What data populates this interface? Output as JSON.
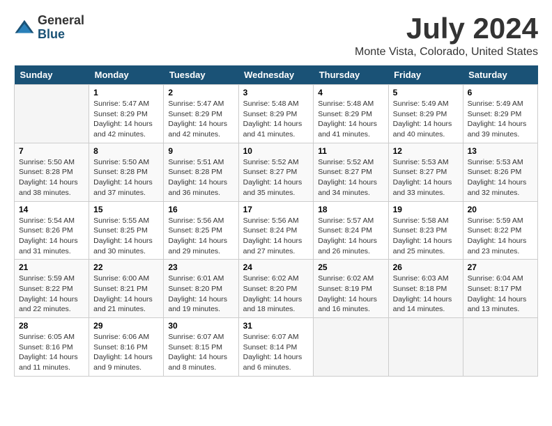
{
  "header": {
    "logo": {
      "general": "General",
      "blue": "Blue"
    },
    "title": "July 2024",
    "location": "Monte Vista, Colorado, United States"
  },
  "calendar": {
    "days_of_week": [
      "Sunday",
      "Monday",
      "Tuesday",
      "Wednesday",
      "Thursday",
      "Friday",
      "Saturday"
    ],
    "weeks": [
      [
        {
          "day": "",
          "detail": ""
        },
        {
          "day": "1",
          "detail": "Sunrise: 5:47 AM\nSunset: 8:29 PM\nDaylight: 14 hours\nand 42 minutes."
        },
        {
          "day": "2",
          "detail": "Sunrise: 5:47 AM\nSunset: 8:29 PM\nDaylight: 14 hours\nand 42 minutes."
        },
        {
          "day": "3",
          "detail": "Sunrise: 5:48 AM\nSunset: 8:29 PM\nDaylight: 14 hours\nand 41 minutes."
        },
        {
          "day": "4",
          "detail": "Sunrise: 5:48 AM\nSunset: 8:29 PM\nDaylight: 14 hours\nand 41 minutes."
        },
        {
          "day": "5",
          "detail": "Sunrise: 5:49 AM\nSunset: 8:29 PM\nDaylight: 14 hours\nand 40 minutes."
        },
        {
          "day": "6",
          "detail": "Sunrise: 5:49 AM\nSunset: 8:29 PM\nDaylight: 14 hours\nand 39 minutes."
        }
      ],
      [
        {
          "day": "7",
          "detail": "Sunrise: 5:50 AM\nSunset: 8:28 PM\nDaylight: 14 hours\nand 38 minutes."
        },
        {
          "day": "8",
          "detail": "Sunrise: 5:50 AM\nSunset: 8:28 PM\nDaylight: 14 hours\nand 37 minutes."
        },
        {
          "day": "9",
          "detail": "Sunrise: 5:51 AM\nSunset: 8:28 PM\nDaylight: 14 hours\nand 36 minutes."
        },
        {
          "day": "10",
          "detail": "Sunrise: 5:52 AM\nSunset: 8:27 PM\nDaylight: 14 hours\nand 35 minutes."
        },
        {
          "day": "11",
          "detail": "Sunrise: 5:52 AM\nSunset: 8:27 PM\nDaylight: 14 hours\nand 34 minutes."
        },
        {
          "day": "12",
          "detail": "Sunrise: 5:53 AM\nSunset: 8:27 PM\nDaylight: 14 hours\nand 33 minutes."
        },
        {
          "day": "13",
          "detail": "Sunrise: 5:53 AM\nSunset: 8:26 PM\nDaylight: 14 hours\nand 32 minutes."
        }
      ],
      [
        {
          "day": "14",
          "detail": "Sunrise: 5:54 AM\nSunset: 8:26 PM\nDaylight: 14 hours\nand 31 minutes."
        },
        {
          "day": "15",
          "detail": "Sunrise: 5:55 AM\nSunset: 8:25 PM\nDaylight: 14 hours\nand 30 minutes."
        },
        {
          "day": "16",
          "detail": "Sunrise: 5:56 AM\nSunset: 8:25 PM\nDaylight: 14 hours\nand 29 minutes."
        },
        {
          "day": "17",
          "detail": "Sunrise: 5:56 AM\nSunset: 8:24 PM\nDaylight: 14 hours\nand 27 minutes."
        },
        {
          "day": "18",
          "detail": "Sunrise: 5:57 AM\nSunset: 8:24 PM\nDaylight: 14 hours\nand 26 minutes."
        },
        {
          "day": "19",
          "detail": "Sunrise: 5:58 AM\nSunset: 8:23 PM\nDaylight: 14 hours\nand 25 minutes."
        },
        {
          "day": "20",
          "detail": "Sunrise: 5:59 AM\nSunset: 8:22 PM\nDaylight: 14 hours\nand 23 minutes."
        }
      ],
      [
        {
          "day": "21",
          "detail": "Sunrise: 5:59 AM\nSunset: 8:22 PM\nDaylight: 14 hours\nand 22 minutes."
        },
        {
          "day": "22",
          "detail": "Sunrise: 6:00 AM\nSunset: 8:21 PM\nDaylight: 14 hours\nand 21 minutes."
        },
        {
          "day": "23",
          "detail": "Sunrise: 6:01 AM\nSunset: 8:20 PM\nDaylight: 14 hours\nand 19 minutes."
        },
        {
          "day": "24",
          "detail": "Sunrise: 6:02 AM\nSunset: 8:20 PM\nDaylight: 14 hours\nand 18 minutes."
        },
        {
          "day": "25",
          "detail": "Sunrise: 6:02 AM\nSunset: 8:19 PM\nDaylight: 14 hours\nand 16 minutes."
        },
        {
          "day": "26",
          "detail": "Sunrise: 6:03 AM\nSunset: 8:18 PM\nDaylight: 14 hours\nand 14 minutes."
        },
        {
          "day": "27",
          "detail": "Sunrise: 6:04 AM\nSunset: 8:17 PM\nDaylight: 14 hours\nand 13 minutes."
        }
      ],
      [
        {
          "day": "28",
          "detail": "Sunrise: 6:05 AM\nSunset: 8:16 PM\nDaylight: 14 hours\nand 11 minutes."
        },
        {
          "day": "29",
          "detail": "Sunrise: 6:06 AM\nSunset: 8:16 PM\nDaylight: 14 hours\nand 9 minutes."
        },
        {
          "day": "30",
          "detail": "Sunrise: 6:07 AM\nSunset: 8:15 PM\nDaylight: 14 hours\nand 8 minutes."
        },
        {
          "day": "31",
          "detail": "Sunrise: 6:07 AM\nSunset: 8:14 PM\nDaylight: 14 hours\nand 6 minutes."
        },
        {
          "day": "",
          "detail": ""
        },
        {
          "day": "",
          "detail": ""
        },
        {
          "day": "",
          "detail": ""
        }
      ]
    ]
  }
}
